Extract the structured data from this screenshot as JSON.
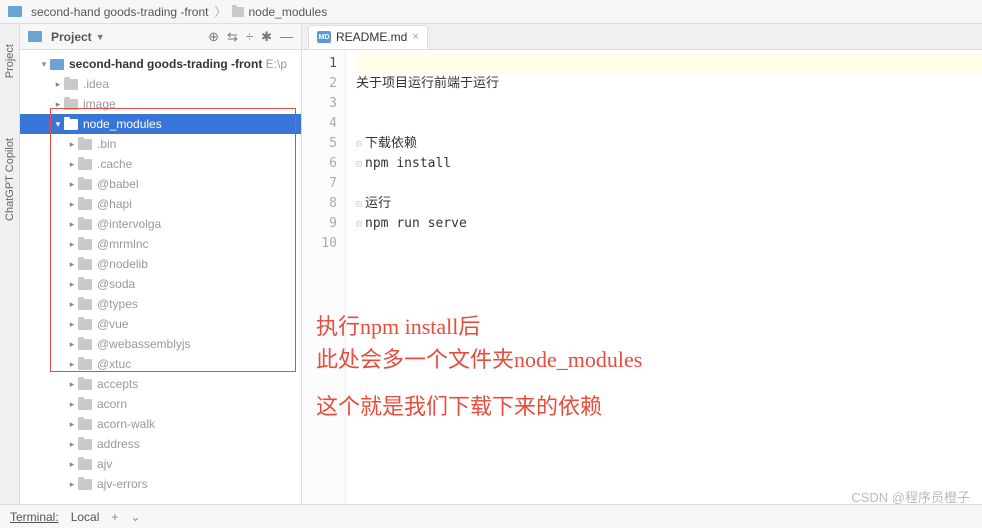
{
  "breadcrumb": {
    "root": "second-hand goods-trading -front",
    "current": "node_modules"
  },
  "left_gutter": {
    "project": "Project",
    "copilot": "ChatGPT Copilot"
  },
  "panel": {
    "title": "Project",
    "tools": {
      "target": "⊕",
      "collapse": "⇆",
      "divide": "÷",
      "settings": "✱",
      "hide": "—"
    }
  },
  "tree": {
    "root": {
      "label": "second-hand goods-trading -front",
      "suffix": " E:\\p"
    },
    "idea": ".idea",
    "image": "image",
    "node_modules": "node_modules",
    "children": [
      ".bin",
      ".cache",
      "@babel",
      "@hapi",
      "@intervolga",
      "@mrmlnc",
      "@nodelib",
      "@soda",
      "@types",
      "@vue",
      "@webassemblyjs",
      "@xtuc",
      "accepts",
      "acorn",
      "acorn-walk",
      "address",
      "ajv",
      "ajv-errors"
    ]
  },
  "tab": {
    "filename": "README.md",
    "icon_text": "MD"
  },
  "code": {
    "lines": [
      "",
      "关于项目运行前端于运行",
      "",
      "",
      "下载依赖",
      "npm install",
      "",
      "运行",
      "npm run serve",
      ""
    ]
  },
  "annotation": {
    "line1": "执行npm install后",
    "line2": "此处会多一个文件夹node_modules",
    "line3": "这个就是我们下载下来的依赖"
  },
  "watermark": "CSDN @程序员橙子",
  "bottom": {
    "terminal": "Terminal:",
    "local": "Local"
  }
}
